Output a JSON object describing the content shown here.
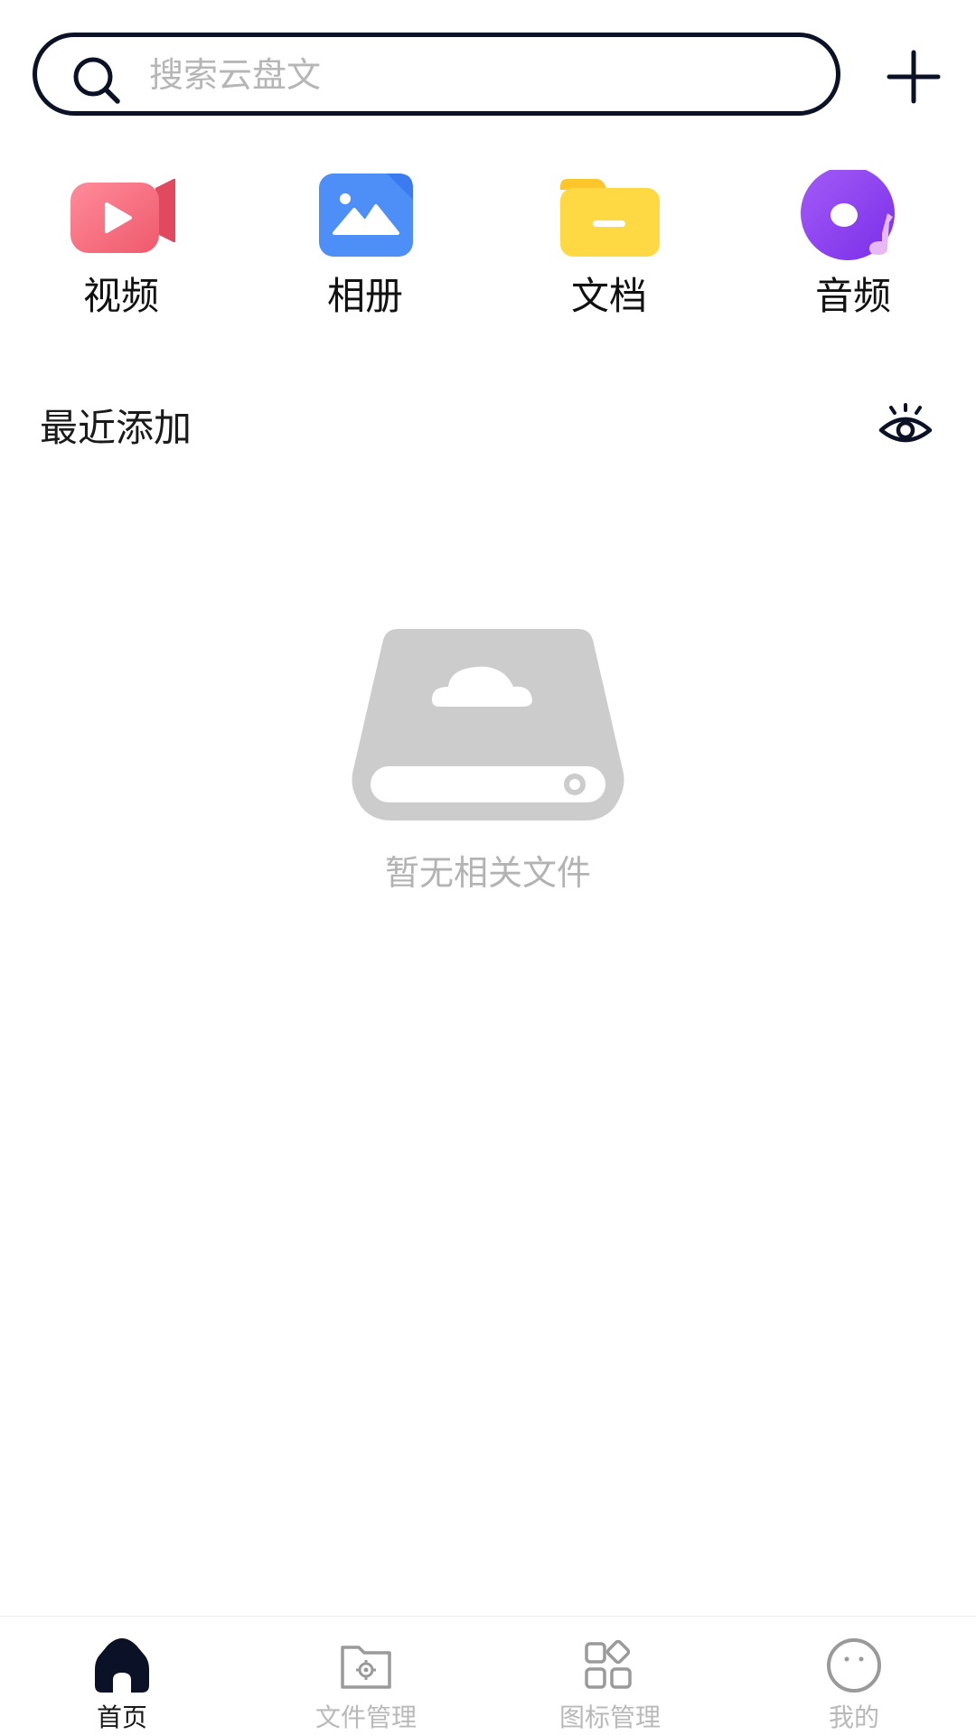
{
  "search": {
    "placeholder": "搜索云盘文",
    "value": ""
  },
  "categories": [
    {
      "label": "视频",
      "icon": "video-camera-icon",
      "color": "#f5606f"
    },
    {
      "label": "相册",
      "icon": "photo-album-icon",
      "color": "#4d8ef7"
    },
    {
      "label": "文档",
      "icon": "folder-icon",
      "color": "#ffd340"
    },
    {
      "label": "音频",
      "icon": "music-disc-icon",
      "color": "#8a3cf0"
    }
  ],
  "recent": {
    "title": "最近添加",
    "toggle_icon": "eye-icon"
  },
  "empty_state": {
    "icon": "cloud-drive-icon",
    "text": "暂无相关文件"
  },
  "bottom_nav": [
    {
      "label": "首页",
      "icon": "home-icon",
      "active": true
    },
    {
      "label": "文件管理",
      "icon": "folder-settings-icon",
      "active": false
    },
    {
      "label": "图标管理",
      "icon": "apps-grid-icon",
      "active": false
    },
    {
      "label": "我的",
      "icon": "profile-face-icon",
      "active": false
    }
  ],
  "colors": {
    "primary": "#0b1126",
    "muted_text": "#b9b9b9",
    "empty_gray": "#cccccc"
  }
}
